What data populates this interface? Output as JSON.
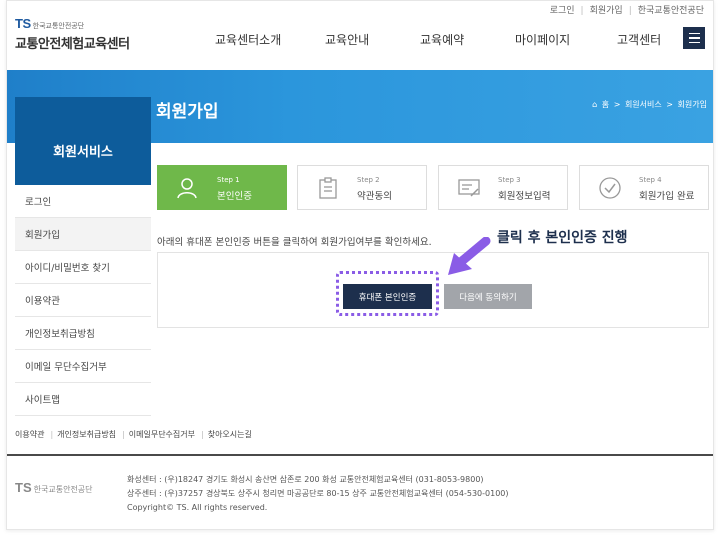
{
  "utility": {
    "links": [
      "로그인",
      "회원가입",
      "한국교통안전공단"
    ]
  },
  "header": {
    "logo_mark": "TS",
    "logo_org": "한국교통안전공단",
    "logo_name": "교통안전체험교육센터",
    "nav": [
      "교육센터소개",
      "교육안내",
      "교육예약",
      "마이페이지",
      "고객센터"
    ]
  },
  "page": {
    "title": "회원가입",
    "breadcrumb": [
      "홈",
      "회원서비스",
      "회원가입"
    ]
  },
  "sidebar": {
    "title": "회원서비스",
    "items": [
      "로그인",
      "회원가입",
      "아이디/비밀번호 찾기",
      "이용약관",
      "개인정보취급방침",
      "이메일 무단수집거부",
      "사이트맵"
    ],
    "active_index": 1
  },
  "steps": [
    {
      "step": "Step 1",
      "label": "본인인증",
      "active": true
    },
    {
      "step": "Step 2",
      "label": "약관동의",
      "active": false
    },
    {
      "step": "Step 3",
      "label": "회원정보입력",
      "active": false
    },
    {
      "step": "Step 4",
      "label": "회원가입 완료",
      "active": false
    }
  ],
  "content": {
    "info": "아래의 휴대폰 본인인증 버튼을 클릭하여 회원가입여부를 확인하세요.",
    "callout": "클릭 후 본인인증 진행",
    "primary_button": "휴대폰 본인인증",
    "secondary_button": "다음에 동의하기"
  },
  "footer": {
    "links": [
      "이용약관",
      "개인정보취급방침",
      "이메일무단수집거부",
      "찾아오시는길"
    ],
    "logo_mark": "TS",
    "logo_org": "한국교통안전공단",
    "address1": "화성센터 : (우)18247 경기도 화성시 송산면 삼존로 200 화성 교통안전체험교육센터 (031-8053-9800)",
    "address2": "상주센터 : (우)37257 경상북도 상주시 청리면 마공공단로 80-15 상주 교통안전체험교육센터 (054-530-0100)",
    "copyright": "Copyright© TS. All rights reserved."
  },
  "colors": {
    "brand_navy": "#1d2f4d",
    "brand_blue": "#2b96dc",
    "step_active": "#6fb84a",
    "highlight": "#8a5ce6"
  }
}
